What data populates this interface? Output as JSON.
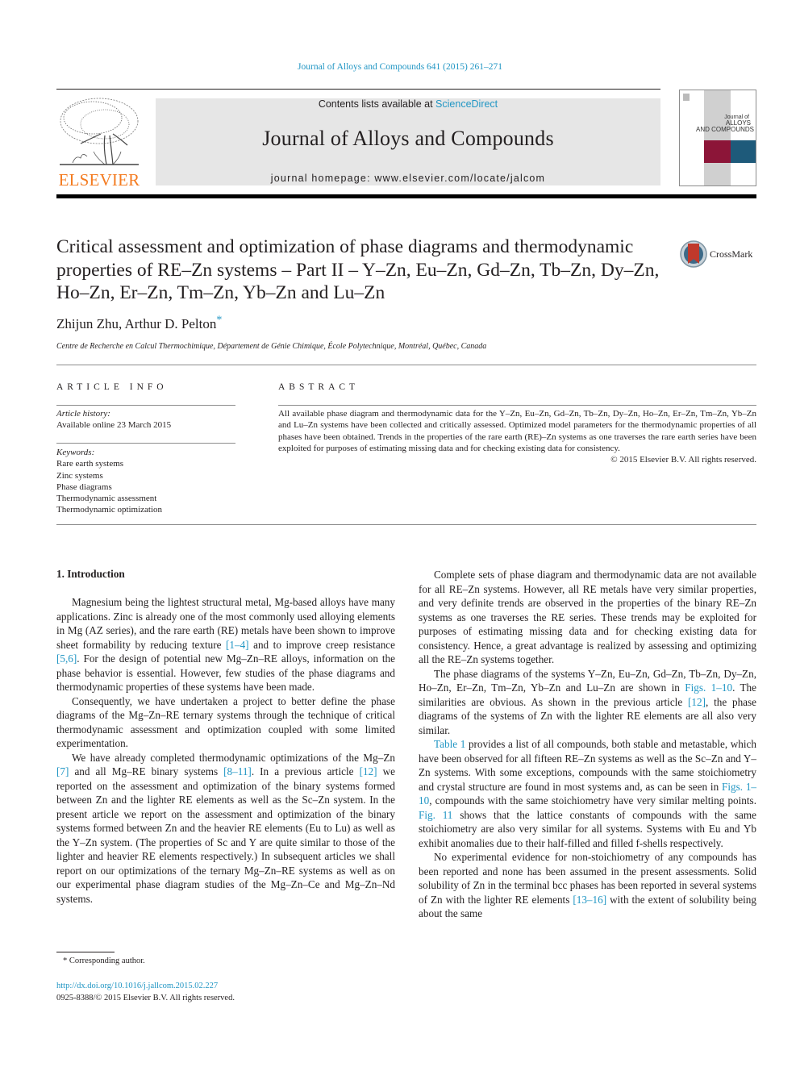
{
  "header": {
    "citation": "Journal of Alloys and Compounds 641 (2015) 261–271",
    "contents_prefix": "Contents lists available at ",
    "contents_link": "ScienceDirect",
    "journal_title": "Journal of Alloys and Compounds",
    "homepage": "journal homepage: www.elsevier.com/locate/jalcom",
    "publisher_logo_text": "ELSEVIER",
    "cover": {
      "line1": "Journal of",
      "line2": "ALLOYS",
      "line3": "AND COMPOUNDS"
    },
    "colors": {
      "link": "#2196c4",
      "elsevier_orange": "#f47b20",
      "cover_maroon": "#8c1538",
      "cover_blue": "#1e5a7a"
    }
  },
  "article": {
    "title": "Critical assessment and optimization of phase diagrams and thermodynamic properties of RE–Zn systems – Part II – Y–Zn, Eu–Zn, Gd–Zn, Tb–Zn, Dy–Zn, Ho–Zn, Er–Zn, Tm–Zn, Yb–Zn and Lu–Zn",
    "crossmark_label": "CrossMark",
    "authors": "Zhijun Zhu, Arthur D. Pelton",
    "author_mark": "*",
    "affiliation": "Centre de Recherche en Calcul Thermochimique, Département de Génie Chimique, École Polytechnique, Montréal, Québec, Canada"
  },
  "article_info": {
    "heading": "ARTICLE INFO",
    "history_label": "Article history:",
    "history_value": "Available online 23 March 2015",
    "keywords_label": "Keywords:",
    "keywords": [
      "Rare earth systems",
      "Zinc systems",
      "Phase diagrams",
      "Thermodynamic assessment",
      "Thermodynamic optimization"
    ]
  },
  "abstract": {
    "heading": "ABSTRACT",
    "text": "All available phase diagram and thermodynamic data for the Y–Zn, Eu–Zn, Gd–Zn, Tb–Zn, Dy–Zn, Ho–Zn, Er–Zn, Tm–Zn, Yb–Zn and Lu–Zn systems have been collected and critically assessed. Optimized model parameters for the thermodynamic properties of all phases have been obtained. Trends in the properties of the rare earth (RE)–Zn systems as one traverses the rare earth series have been exploited for purposes of estimating missing data and for checking existing data for consistency.",
    "copyright": "© 2015 Elsevier B.V. All rights reserved."
  },
  "body": {
    "section_title": "1. Introduction",
    "left": {
      "p1": {
        "a": "Magnesium being the lightest structural metal, Mg-based alloys have many applications. Zinc is already one of the most commonly used alloying elements in Mg (AZ series), and the rare earth (RE) metals have been shown to improve sheet formability by reducing texture ",
        "ref1": "[1–4]",
        "b": " and to improve creep resistance ",
        "ref2": "[5,6]",
        "c": ". For the design of potential new Mg–Zn–RE alloys, information on the phase behavior is essential. However, few studies of the phase diagrams and thermodynamic properties of these systems have been made."
      },
      "p2": "Consequently, we have undertaken a project to better define the phase diagrams of the Mg–Zn–RE ternary systems through the technique of critical thermodynamic assessment and optimization coupled with some limited experimentation.",
      "p3": {
        "a": "We have already completed thermodynamic optimizations of the Mg–Zn ",
        "ref1": "[7]",
        "b": " and all Mg–RE binary systems ",
        "ref2": "[8–11]",
        "c": ". In a previous article ",
        "ref3": "[12]",
        "d": " we reported on the assessment and optimization of the binary systems formed between Zn and the lighter RE elements as well as the Sc–Zn system. In the present article we report on the assessment and optimization of the binary systems formed between Zn and the heavier RE elements (Eu to Lu) as well as the Y–Zn system. (The properties of Sc and Y are quite similar to those of the lighter and heavier RE elements respectively.) In sub­sequent articles we shall report on our optimizations of the ternary Mg–Zn–RE systems as well as on our experimental phase diagram studies of the Mg–Zn–Ce and Mg–Zn–Nd systems."
      }
    },
    "right": {
      "p1": "Complete sets of phase diagram and thermodynamic data are not available for all RE–Zn systems. However, all RE metals have very similar properties, and very definite trends are observed in the properties of the binary RE–Zn systems as one traverses the RE series. These trends may be exploited for purposes of estimating missing data and for checking existing data for consistency. Hence, a great advantage is realized by assessing and optimizing all the RE–Zn systems together.",
      "p2": {
        "a": "The phase diagrams of the systems Y–Zn, Eu–Zn, Gd–Zn, Tb–Zn, Dy–Zn, Ho–Zn, Er–Zn, Tm–Zn, Yb–Zn and Lu–Zn are shown in ",
        "ref1": "Figs. 1–10",
        "b": ". The similarities are obvious. As shown in the previous article ",
        "ref2": "[12]",
        "c": ", the phase diagrams of the systems of Zn with the lighter RE elements are all also very similar."
      },
      "p3": {
        "ref1": "Table 1",
        "a": " provides a list of all compounds, both stable and meta­stable, which have been observed for all fifteen RE–Zn systems as well as the Sc–Zn and Y–Zn systems. With some exceptions, com­pounds with the same stoichiometry and crystal structure are found in most systems and, as can be seen in ",
        "ref2": "Figs. 1–10",
        "b": ", com­pounds with the same stoichiometry have very similar melting points. ",
        "ref3": "Fig. 11",
        "c": " shows that the lattice constants of compounds with the same stoichiometry are also very similar for all systems. Systems with Eu and Yb exhibit anomalies due to their half-filled and filled f-shells respectively."
      },
      "p4": {
        "a": "No experimental evidence for non-stoichiometry of any com­pounds has been reported and none has been assumed in the pre­sent assessments. Solid solubility of Zn in the terminal bcc phases has been reported in several systems of Zn with the lighter RE ele­ments ",
        "ref1": "[13–16]",
        "b": " with the extent of solubility being about the same"
      }
    }
  },
  "footer": {
    "footnote": "* Corresponding author.",
    "doi": "http://dx.doi.org/10.1016/j.jallcom.2015.02.227",
    "issn": "0925-8388/© 2015 Elsevier B.V. All rights reserved."
  }
}
